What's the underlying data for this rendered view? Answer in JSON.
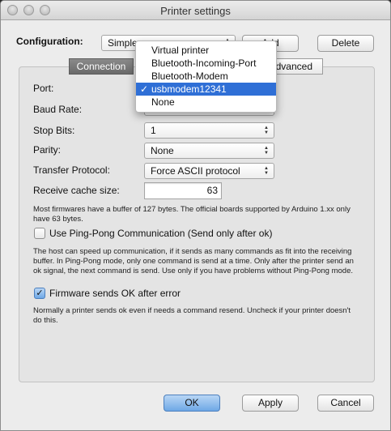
{
  "window": {
    "title": "Printer settings"
  },
  "config": {
    "label": "Configuration:",
    "value": "Simple",
    "add_label": "Add",
    "delete_label": "Delete"
  },
  "tabs": [
    {
      "label": "Connection",
      "selected": true
    },
    {
      "label": "Advanced",
      "selected": false
    }
  ],
  "dropdown": {
    "items": [
      {
        "label": "Virtual printer",
        "checked": false
      },
      {
        "label": "Bluetooth-Incoming-Port",
        "checked": false
      },
      {
        "label": "Bluetooth-Modem",
        "checked": false
      },
      {
        "label": "usbmodem12341",
        "checked": true
      },
      {
        "label": "None",
        "checked": false
      }
    ],
    "check_glyph": "✓"
  },
  "form": {
    "port_label": "Port:",
    "baud_label": "Baud Rate:",
    "stopbits_label": "Stop Bits:",
    "stopbits_value": "1",
    "parity_label": "Parity:",
    "parity_value": "None",
    "protocol_label": "Transfer Protocol:",
    "protocol_value": "Force ASCII protocol",
    "cache_label": "Receive cache size:",
    "cache_value": "63",
    "cache_note": "Most firmwares have a buffer of 127 bytes. The official boards supported by Arduino 1.xx only have 63 bytes.",
    "pingpong_label": "Use Ping-Pong Communication (Send only after ok)",
    "pingpong_checked": false,
    "pingpong_note": "The host can speed up communication, if it sends as many commands as fit into the receiving buffer. In Ping-Pong mode, only one command is send at a time. Only after the printer send an ok signal, the next command is send. Use only if you have problems without Ping-Pong mode.",
    "okerror_label": "Firmware sends OK after error",
    "okerror_checked": true,
    "okerror_note": "Normally a printer sends ok even if needs a command resend. Uncheck if your printer doesn't do this."
  },
  "buttons": {
    "ok": "OK",
    "apply": "Apply",
    "cancel": "Cancel"
  },
  "icons": {
    "popup_arrows": "updown-arrows-icon",
    "checkmark": "checkmark-icon"
  },
  "colors": {
    "selection": "#2f6fd6",
    "default_button": "#6ea8e6"
  }
}
